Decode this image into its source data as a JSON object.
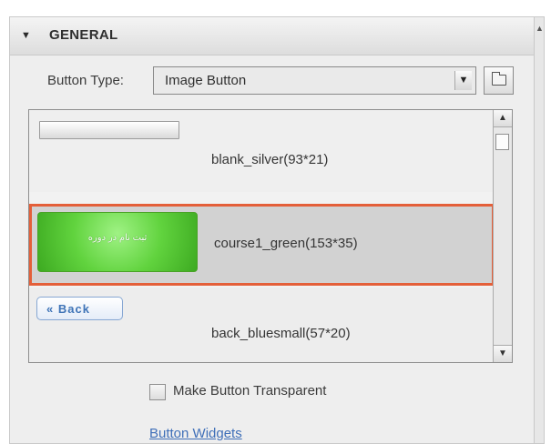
{
  "general": {
    "title": "GENERAL",
    "collapse_icon": "triangle-down-icon"
  },
  "button_type": {
    "label": "Button Type:",
    "value": "Image Button",
    "dropdown_icon": "chevron-down-icon",
    "folder_icon": "folder-icon"
  },
  "button_list": {
    "items": [
      {
        "label": "blank_silver(93*21)",
        "preview_text": "",
        "selected": false
      },
      {
        "label": "course1_green(153*35)",
        "preview_text": "ثبت نام در دوره",
        "selected": true
      },
      {
        "label": "back_bluesmall(57*20)",
        "preview_text": "« Back",
        "selected": false
      }
    ]
  },
  "options": {
    "transparent_label": "Make Button Transparent",
    "widgets_link": "Button Widgets"
  },
  "colors": {
    "selection_border": "#e45f39",
    "selected_background": "#d2d2d2",
    "link": "#3f6fb8"
  }
}
